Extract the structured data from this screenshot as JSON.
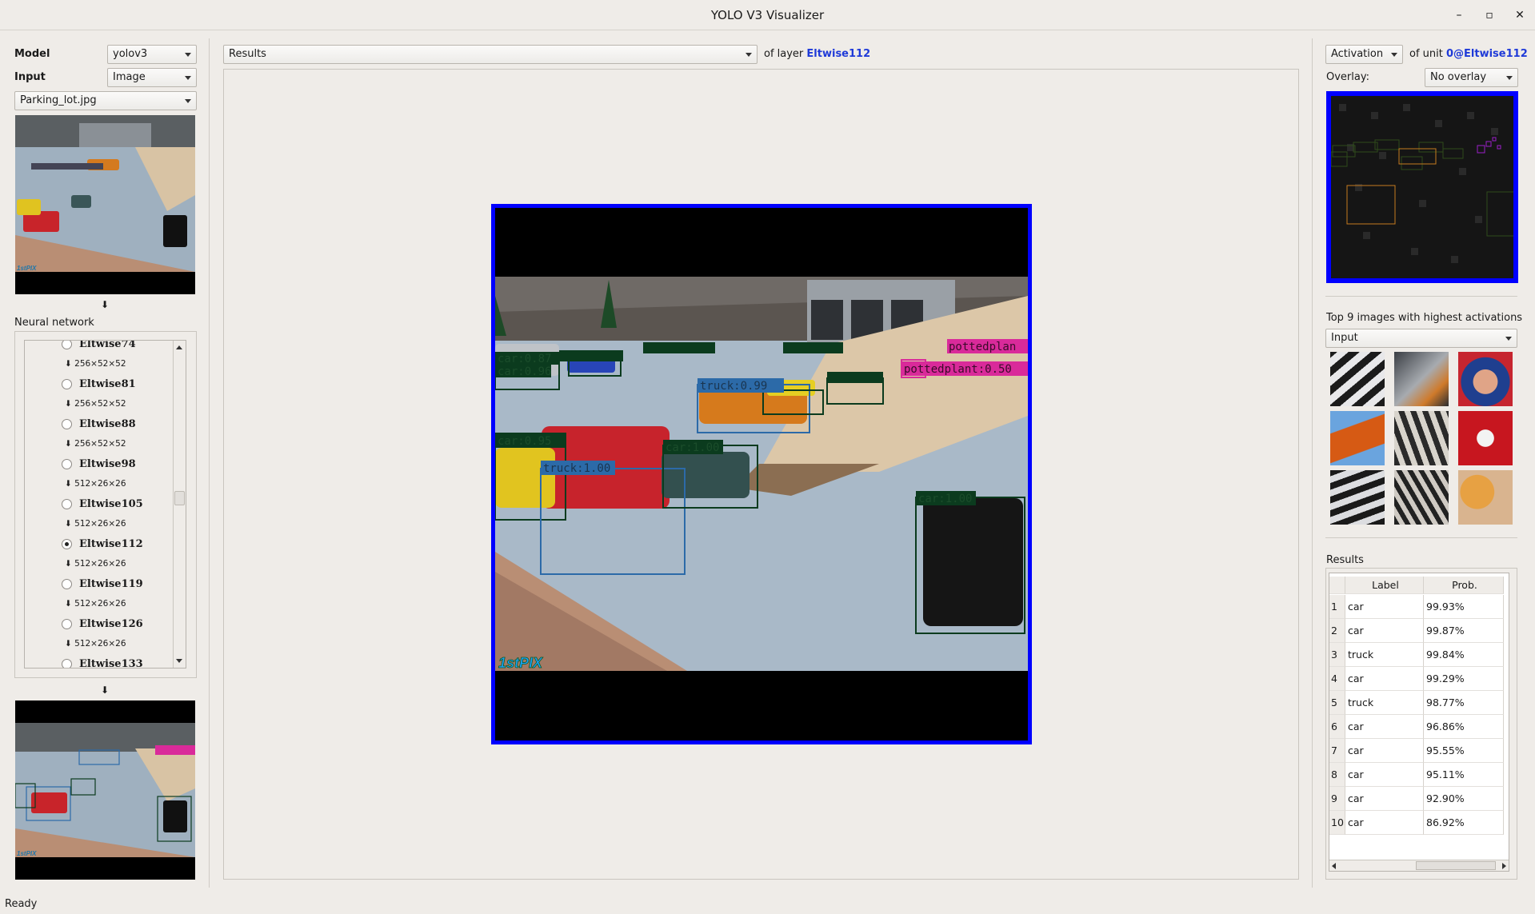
{
  "window": {
    "title": "YOLO V3 Visualizer",
    "minimize": "–",
    "maximize": "▫",
    "close": "✕"
  },
  "left": {
    "model_label": "Model",
    "model_value": "yolov3",
    "input_label": "Input",
    "input_value": "Image",
    "file_value": "Parking_lot.jpg",
    "arrow_down": "⬇",
    "nn_label": "Neural network",
    "tree": [
      {
        "name": "Eltwise74",
        "selected": false
      },
      {
        "dim": "⬇ 256×52×52"
      },
      {
        "name": "Eltwise81",
        "selected": false
      },
      {
        "dim": "⬇ 256×52×52"
      },
      {
        "name": "Eltwise88",
        "selected": false
      },
      {
        "dim": "⬇ 256×52×52"
      },
      {
        "name": "Eltwise98",
        "selected": false
      },
      {
        "dim": "⬇ 512×26×26"
      },
      {
        "name": "Eltwise105",
        "selected": false
      },
      {
        "dim": "⬇ 512×26×26"
      },
      {
        "name": "Eltwise112",
        "selected": true
      },
      {
        "dim": "⬇ 512×26×26"
      },
      {
        "name": "Eltwise119",
        "selected": false
      },
      {
        "dim": "⬇ 512×26×26"
      },
      {
        "name": "Eltwise126",
        "selected": false
      },
      {
        "dim": "⬇ 512×26×26"
      },
      {
        "name": "Eltwise133",
        "selected": false
      }
    ],
    "watermark": "1stPIX"
  },
  "center": {
    "view_value": "Results",
    "of_layer_text": "of layer",
    "layer_name": "Eltwise112",
    "detections": [
      {
        "label": "car:0.87"
      },
      {
        "label": "car:0.96"
      },
      {
        "label": "car:0.95"
      },
      {
        "label": "truck:0.99"
      },
      {
        "label": "truck:1.00"
      },
      {
        "label": "car:1.00"
      },
      {
        "label": "car:1.00"
      },
      {
        "label": "pottedplant:0.50"
      },
      {
        "label": "pottedplan"
      }
    ],
    "watermark": "1stPIX"
  },
  "right": {
    "mode_value": "Activation",
    "of_unit_text": "of unit",
    "unit_name": "0@Eltwise112",
    "overlay_label": "Overlay:",
    "overlay_value": "No overlay",
    "top_label": "Top 9 images with highest activations",
    "top_source_value": "Input",
    "results_label": "Results",
    "table_headers": [
      "Label",
      "Prob."
    ],
    "results": [
      {
        "idx": "1",
        "label": "car",
        "prob": "99.93%"
      },
      {
        "idx": "2",
        "label": "car",
        "prob": "99.87%"
      },
      {
        "idx": "3",
        "label": "truck",
        "prob": "99.84%"
      },
      {
        "idx": "4",
        "label": "car",
        "prob": "99.29%"
      },
      {
        "idx": "5",
        "label": "truck",
        "prob": "98.77%"
      },
      {
        "idx": "6",
        "label": "car",
        "prob": "96.86%"
      },
      {
        "idx": "7",
        "label": "car",
        "prob": "95.55%"
      },
      {
        "idx": "8",
        "label": "car",
        "prob": "95.11%"
      },
      {
        "idx": "9",
        "label": "car",
        "prob": "92.90%"
      },
      {
        "idx": "10",
        "label": "car",
        "prob": "86.92%"
      }
    ]
  },
  "status": {
    "text": "Ready"
  },
  "colors": {
    "accent_blue": "#1f3ad8",
    "frame_blue": "#0000ff",
    "box_green": "#0b3b1e",
    "box_blue": "#2c6aa8",
    "box_pink": "#d92a9a"
  }
}
